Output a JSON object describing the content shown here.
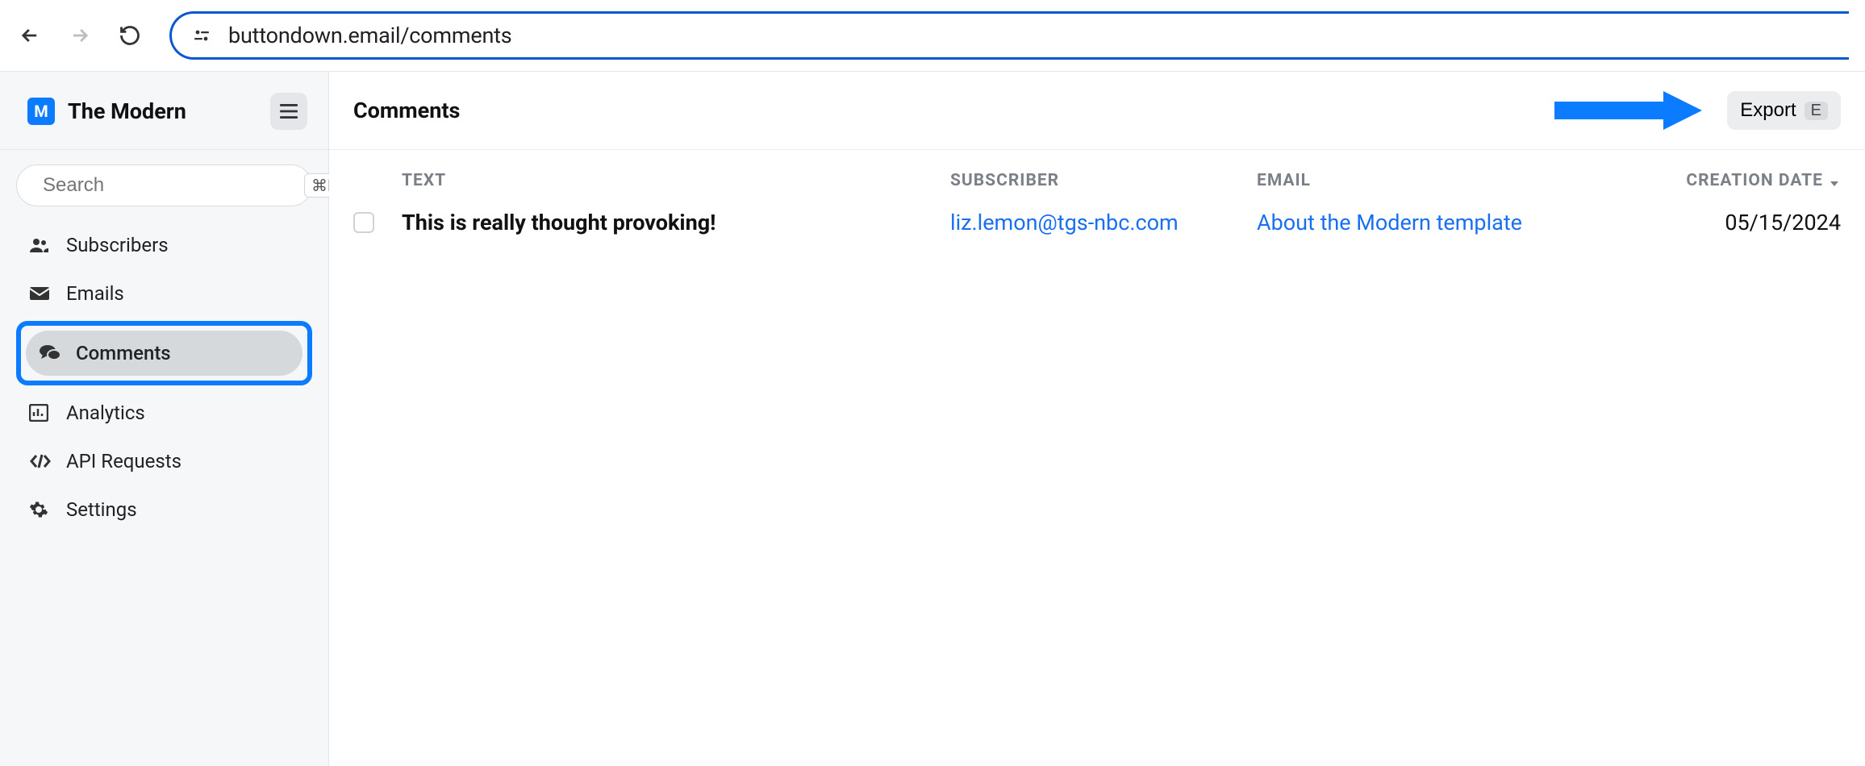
{
  "browser": {
    "url": "buttondown.email/comments"
  },
  "sidebar": {
    "brand_letter": "M",
    "brand_name": "The Modern",
    "search_placeholder": "Search",
    "search_shortcut": "⌘K",
    "items": [
      {
        "icon": "users",
        "label": "Subscribers",
        "active": false
      },
      {
        "icon": "envelope",
        "label": "Emails",
        "active": false
      },
      {
        "icon": "comments",
        "label": "Comments",
        "active": true
      },
      {
        "icon": "chart",
        "label": "Analytics",
        "active": false
      },
      {
        "icon": "code",
        "label": "API Requests",
        "active": false
      },
      {
        "icon": "gear",
        "label": "Settings",
        "active": false
      }
    ]
  },
  "header": {
    "title": "Comments",
    "export_label": "Export",
    "export_key": "E"
  },
  "table": {
    "columns": {
      "text": "TEXT",
      "subscriber": "SUBSCRIBER",
      "email": "EMAIL",
      "creation_date": "CREATION DATE"
    },
    "rows": [
      {
        "text": "This is really thought provoking!",
        "subscriber": "liz.lemon@tgs-nbc.com",
        "email": "About the Modern template",
        "creation_date": "05/15/2024"
      }
    ]
  }
}
